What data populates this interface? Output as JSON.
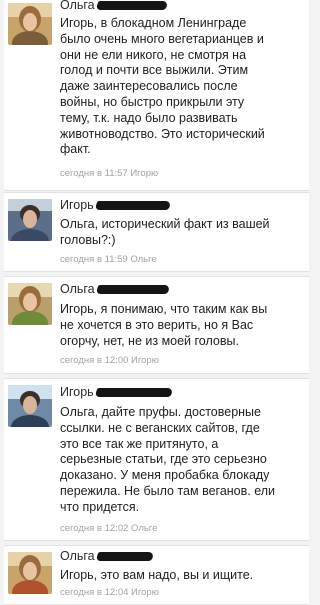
{
  "comments": [
    {
      "author": "Ольга",
      "text": "Игорь, в блокадном Ленинграде\nбыло очень много вегетарианцев и\nони не ели никого, не смотря на\nголод и почти все выжили. Этим\nдаже заинтересовались после\nвойны, но быстро прикрыли эту\nтему, т.к. надо было развивать\nживотноводство. Это исторический\nфакт.",
      "meta": "сегодня в 11:57 Игорю"
    },
    {
      "author": "Игорь",
      "text": "Ольга, исторический факт из вашей\nголовы?:)",
      "meta": "сегодня в 11:59 Ольге"
    },
    {
      "author": "Ольга",
      "text": "Игорь, я понимаю, что таким как вы\nне хочется в это верить, но я Вас\nогорчу, нет, не из моей головы.",
      "meta": "сегодня в 12:00 Игорю"
    },
    {
      "author": "Игорь",
      "text": "Ольга, дайте пруфы. достоверные\nссылки. не с веганских сайтов, где\nэто все так же притянуто, а\nсерьезные статьи, где это серьезно\nдоказано. У меня пробабка блокаду\nпережила. Не было там веганов. ели\nчто придется.",
      "meta": "сегодня в 12:02 Ольге"
    },
    {
      "author": "Ольга",
      "text": "Игорь, это вам надо, вы и ищите.",
      "meta": "сегодня в 12:04 Игорю"
    }
  ]
}
